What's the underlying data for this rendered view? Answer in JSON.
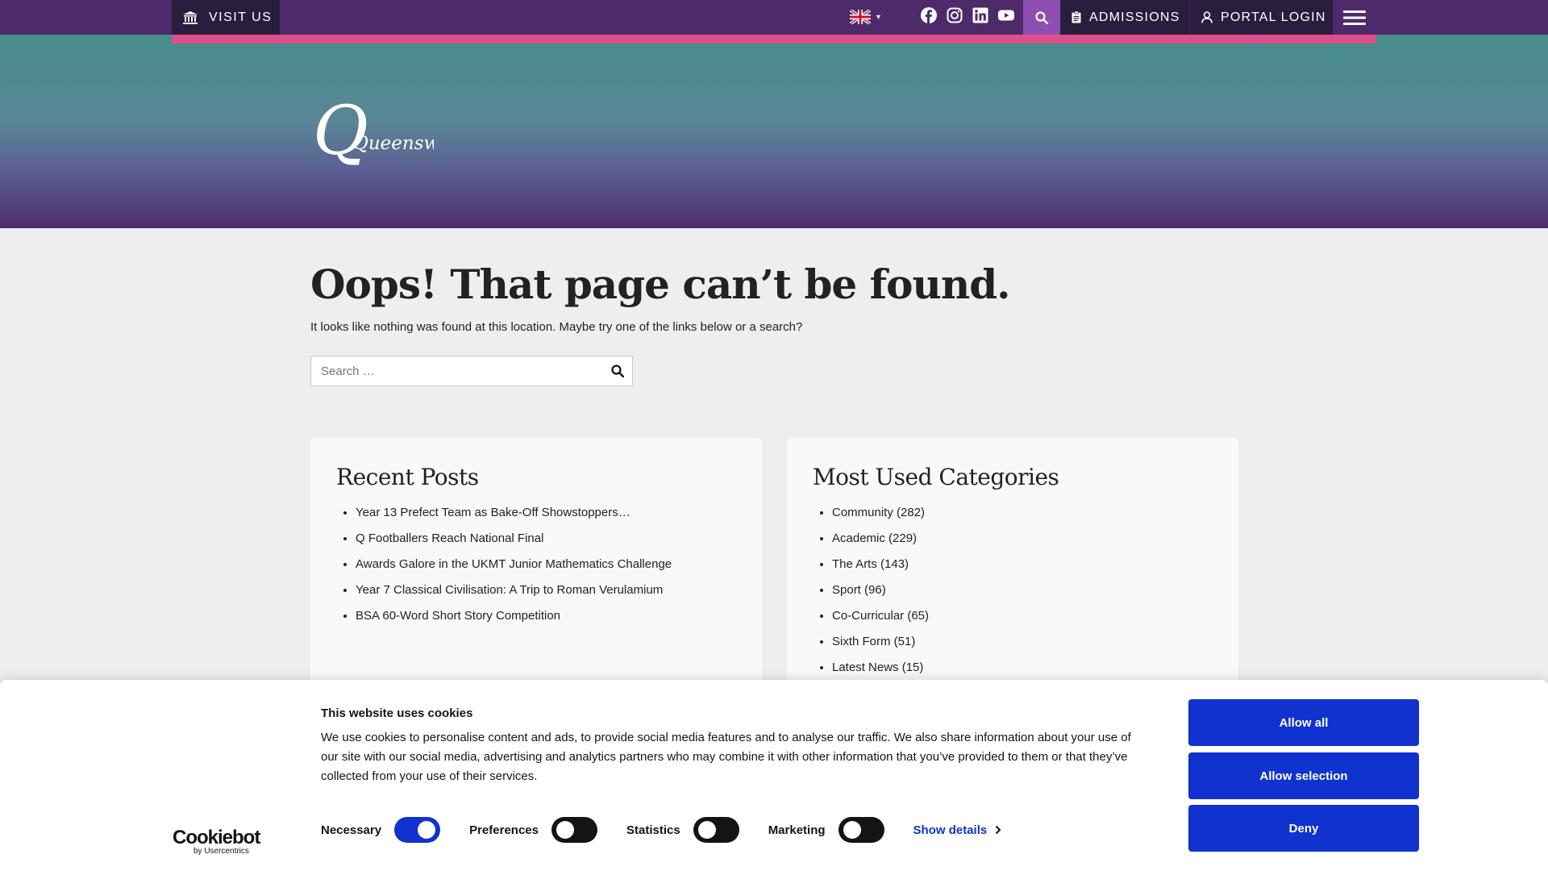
{
  "topbar": {
    "visit_us": "VISIT US",
    "admissions": "ADMISSIONS",
    "portal_login": "PORTAL LOGIN",
    "lang_caret": "▾"
  },
  "brand": {
    "logo_text": "Queenswood"
  },
  "page": {
    "title": "Oops! That page can’t be found.",
    "lead": "It looks like nothing was found at this location. Maybe try one of the links below or a search?",
    "search_placeholder": "Search …"
  },
  "recent_posts": {
    "heading": "Recent Posts",
    "items": [
      "Year 13 Prefect Team as Bake-Off Showstoppers…",
      "Q Footballers Reach National Final",
      "Awards Galore in the UKMT Junior Mathematics Challenge",
      "Year 7 Classical Civilisation: A Trip to Roman Verulamium",
      "BSA 60-Word Short Story Competition"
    ]
  },
  "categories": {
    "heading": "Most Used Categories",
    "items": [
      "Community (282)",
      "Academic (229)",
      "The Arts (143)",
      "Sport (96)",
      "Co-Curricular (65)",
      "Sixth Form (51)",
      "Latest News (15)"
    ]
  },
  "cookie": {
    "logo_main": "Cookiebot",
    "logo_sub": "by Usercentrics",
    "title": "This website uses cookies",
    "text": "We use cookies to personalise content and ads, to provide social media features and to analyse our traffic. We also share information about your use of our site with our social media, advertising and analytics partners who may combine it with other information that you’ve provided to them or that they’ve collected from your use of their services.",
    "toggles": [
      {
        "label": "Necessary",
        "on": true
      },
      {
        "label": "Preferences",
        "on": false
      },
      {
        "label": "Statistics",
        "on": false
      },
      {
        "label": "Marketing",
        "on": false
      }
    ],
    "show_details": "Show details",
    "allow_all": "Allow all",
    "allow_selection": "Allow selection",
    "deny": "Deny"
  },
  "colors": {
    "topbar": "#4e2a6b",
    "topbar_dark": "#2b1d3d",
    "accent_pink": "#dd4f8c",
    "search_purple": "#8e4fb3",
    "cookie_blue": "#1032cf"
  },
  "icons": {
    "visit": "museum-icon",
    "flag": "uk-flag-icon",
    "socials": [
      "facebook-icon",
      "instagram-icon",
      "linkedin-icon",
      "youtube-icon"
    ],
    "search": "search-icon",
    "admissions": "clipboard-icon",
    "portal": "user-icon",
    "menu": "hamburger-icon"
  }
}
